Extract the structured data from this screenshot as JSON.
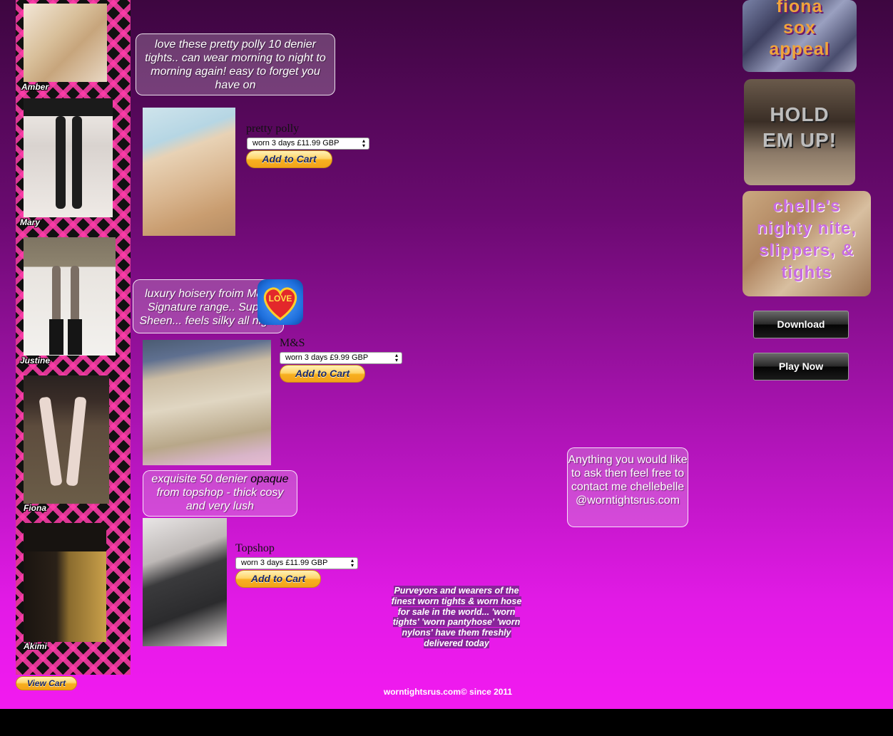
{
  "sidebar": {
    "models": [
      {
        "name": "Amber"
      },
      {
        "name": "Mary"
      },
      {
        "name": "Justine"
      },
      {
        "name": "Fiona"
      },
      {
        "name": "Akimi"
      }
    ]
  },
  "products": [
    {
      "blurb": "love these pretty polly 10 denier tights.. can wear morning to night to morning again! easy to forget you have on",
      "name": "pretty polly",
      "option": "worn 3 days £11.99 GBP",
      "button": "Add to Cart"
    },
    {
      "blurb": "luxury hoisery froim M&S Signature range.. Super Sheen... feels silky all night",
      "name": "M&S",
      "option": "worn 3 days £9.99 GBP",
      "button": "Add to Cart"
    },
    {
      "blurb_before": "exquisite 50 denier ",
      "blurb_highlight": "opaque",
      "blurb_after": " from topshop - thick cosy and very lush",
      "name": "Topshop",
      "option": "worn 3 days £11.99 GBP",
      "button": "Add to Cart"
    }
  ],
  "love_sticker": "LOVE",
  "banners": {
    "fiona": "fiona sox appeal",
    "hold": "HOLD EM UP!",
    "chelle": "chelle's nighty nite, slippers, & tights"
  },
  "buttons": {
    "download": "Download",
    "play": "Play Now",
    "view_cart": "View Cart"
  },
  "contact": "Anything you would like to ask then feel free to contact me chellebelle@worntightsrus.com",
  "tagline": "Purveyors and wearers of the finest worn tights & worn hose for sale in the world... 'worn tights' 'worn pantyhose' 'worn nylons' have them freshly delivered today",
  "footer": "worntightsrus.com© since 2011",
  "colors": {
    "bg_top": "#3d0640",
    "bg_bottom": "#f21af0",
    "tartan_pink": "#ff3caa",
    "paypal_gold": "#f7b020"
  }
}
